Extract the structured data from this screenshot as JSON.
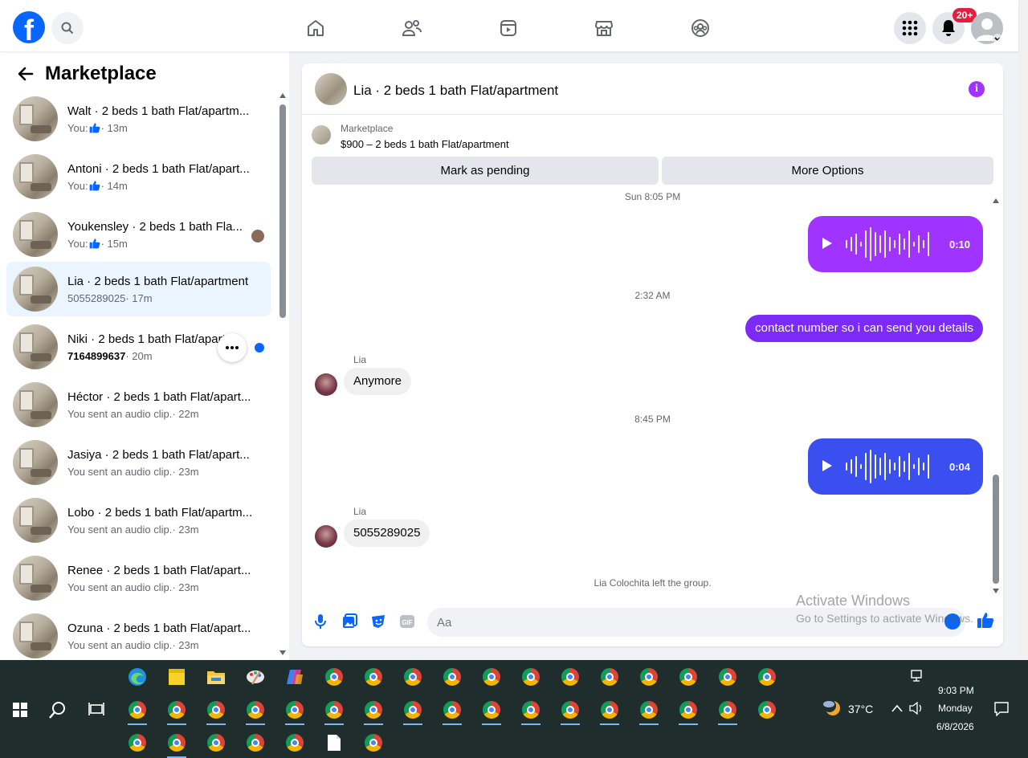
{
  "topbar": {
    "logo": "f",
    "notification_badge": "20+",
    "icons": [
      "search-icon",
      "home-icon",
      "friends-icon",
      "video-icon",
      "marketplace-icon",
      "groups-icon",
      "apps-grid-icon",
      "bell-icon",
      "account-icon"
    ]
  },
  "sidebar": {
    "title": "Marketplace",
    "conversations": [
      {
        "name": "Walt · 2 beds 1 bath Flat/apartm...",
        "sub_prefix": "You:",
        "sub_time": "· 13m",
        "like": true
      },
      {
        "name": "Antoni · 2 beds 1 bath Flat/apart...",
        "sub_prefix": "You:",
        "sub_time": "· 14m",
        "like": true
      },
      {
        "name": "Youkensley · 2 beds 1 bath Fla...",
        "sub_prefix": "You:",
        "sub_time": "· 15m",
        "like": true
      },
      {
        "name": "Lia · 2 beds 1 bath Flat/apartment",
        "sub_prefix": "5055289025",
        "sub_time": "· 17m",
        "active": true
      },
      {
        "name": "Niki · 2 beds 1 bath Flat/apart",
        "sub_prefix": "7164899637",
        "sub_time": "· 20m",
        "unread": true
      },
      {
        "name": "Héctor · 2 beds 1 bath Flat/apart...",
        "sub_prefix": "You sent an audio clip.",
        "sub_time": "· 22m"
      },
      {
        "name": "Jasiya · 2 beds 1 bath Flat/apart...",
        "sub_prefix": "You sent an audio clip.",
        "sub_time": "· 23m"
      },
      {
        "name": "Lobo · 2 beds 1 bath Flat/apartm...",
        "sub_prefix": "You sent an audio clip.",
        "sub_time": "· 23m"
      },
      {
        "name": "Renee · 2 beds 1 bath Flat/apart...",
        "sub_prefix": "You sent an audio clip.",
        "sub_time": "· 23m"
      },
      {
        "name": "Ozuna · 2 beds 1 bath Flat/apart...",
        "sub_prefix": "You sent an audio clip.",
        "sub_time": "· 23m"
      }
    ]
  },
  "chat": {
    "title": "Lia · 2 beds 1 bath Flat/apartment",
    "marketplace_label": "Marketplace",
    "listing": "$900 – 2 beds 1 bath Flat/apartment",
    "mark_pending": "Mark as pending",
    "more_options": "More Options",
    "time1": "Sun 8:05 PM",
    "audio1_duration": "0:10",
    "time2": "2:32 AM",
    "out_message": "contact number so i can send you details",
    "sender1": "Lia",
    "in_message1": "Anymore",
    "time3": "8:45 PM",
    "audio2_duration": "0:04",
    "sender2": "Lia",
    "in_message2": "5055289025",
    "system_message": "Lia Colochita left the group.",
    "input_placeholder": "Aa",
    "colors": {
      "audio1": "#a033ff",
      "audio2": "#3b4ef0",
      "out_bubble": "#7b2bf5"
    }
  },
  "watermark": {
    "line1": "Activate Windows",
    "line2": "Go to Settings to activate Windows."
  },
  "taskbar": {
    "temperature": "37°C",
    "time": "9:03 PM",
    "day": "Monday",
    "date": "6/8/2026"
  }
}
